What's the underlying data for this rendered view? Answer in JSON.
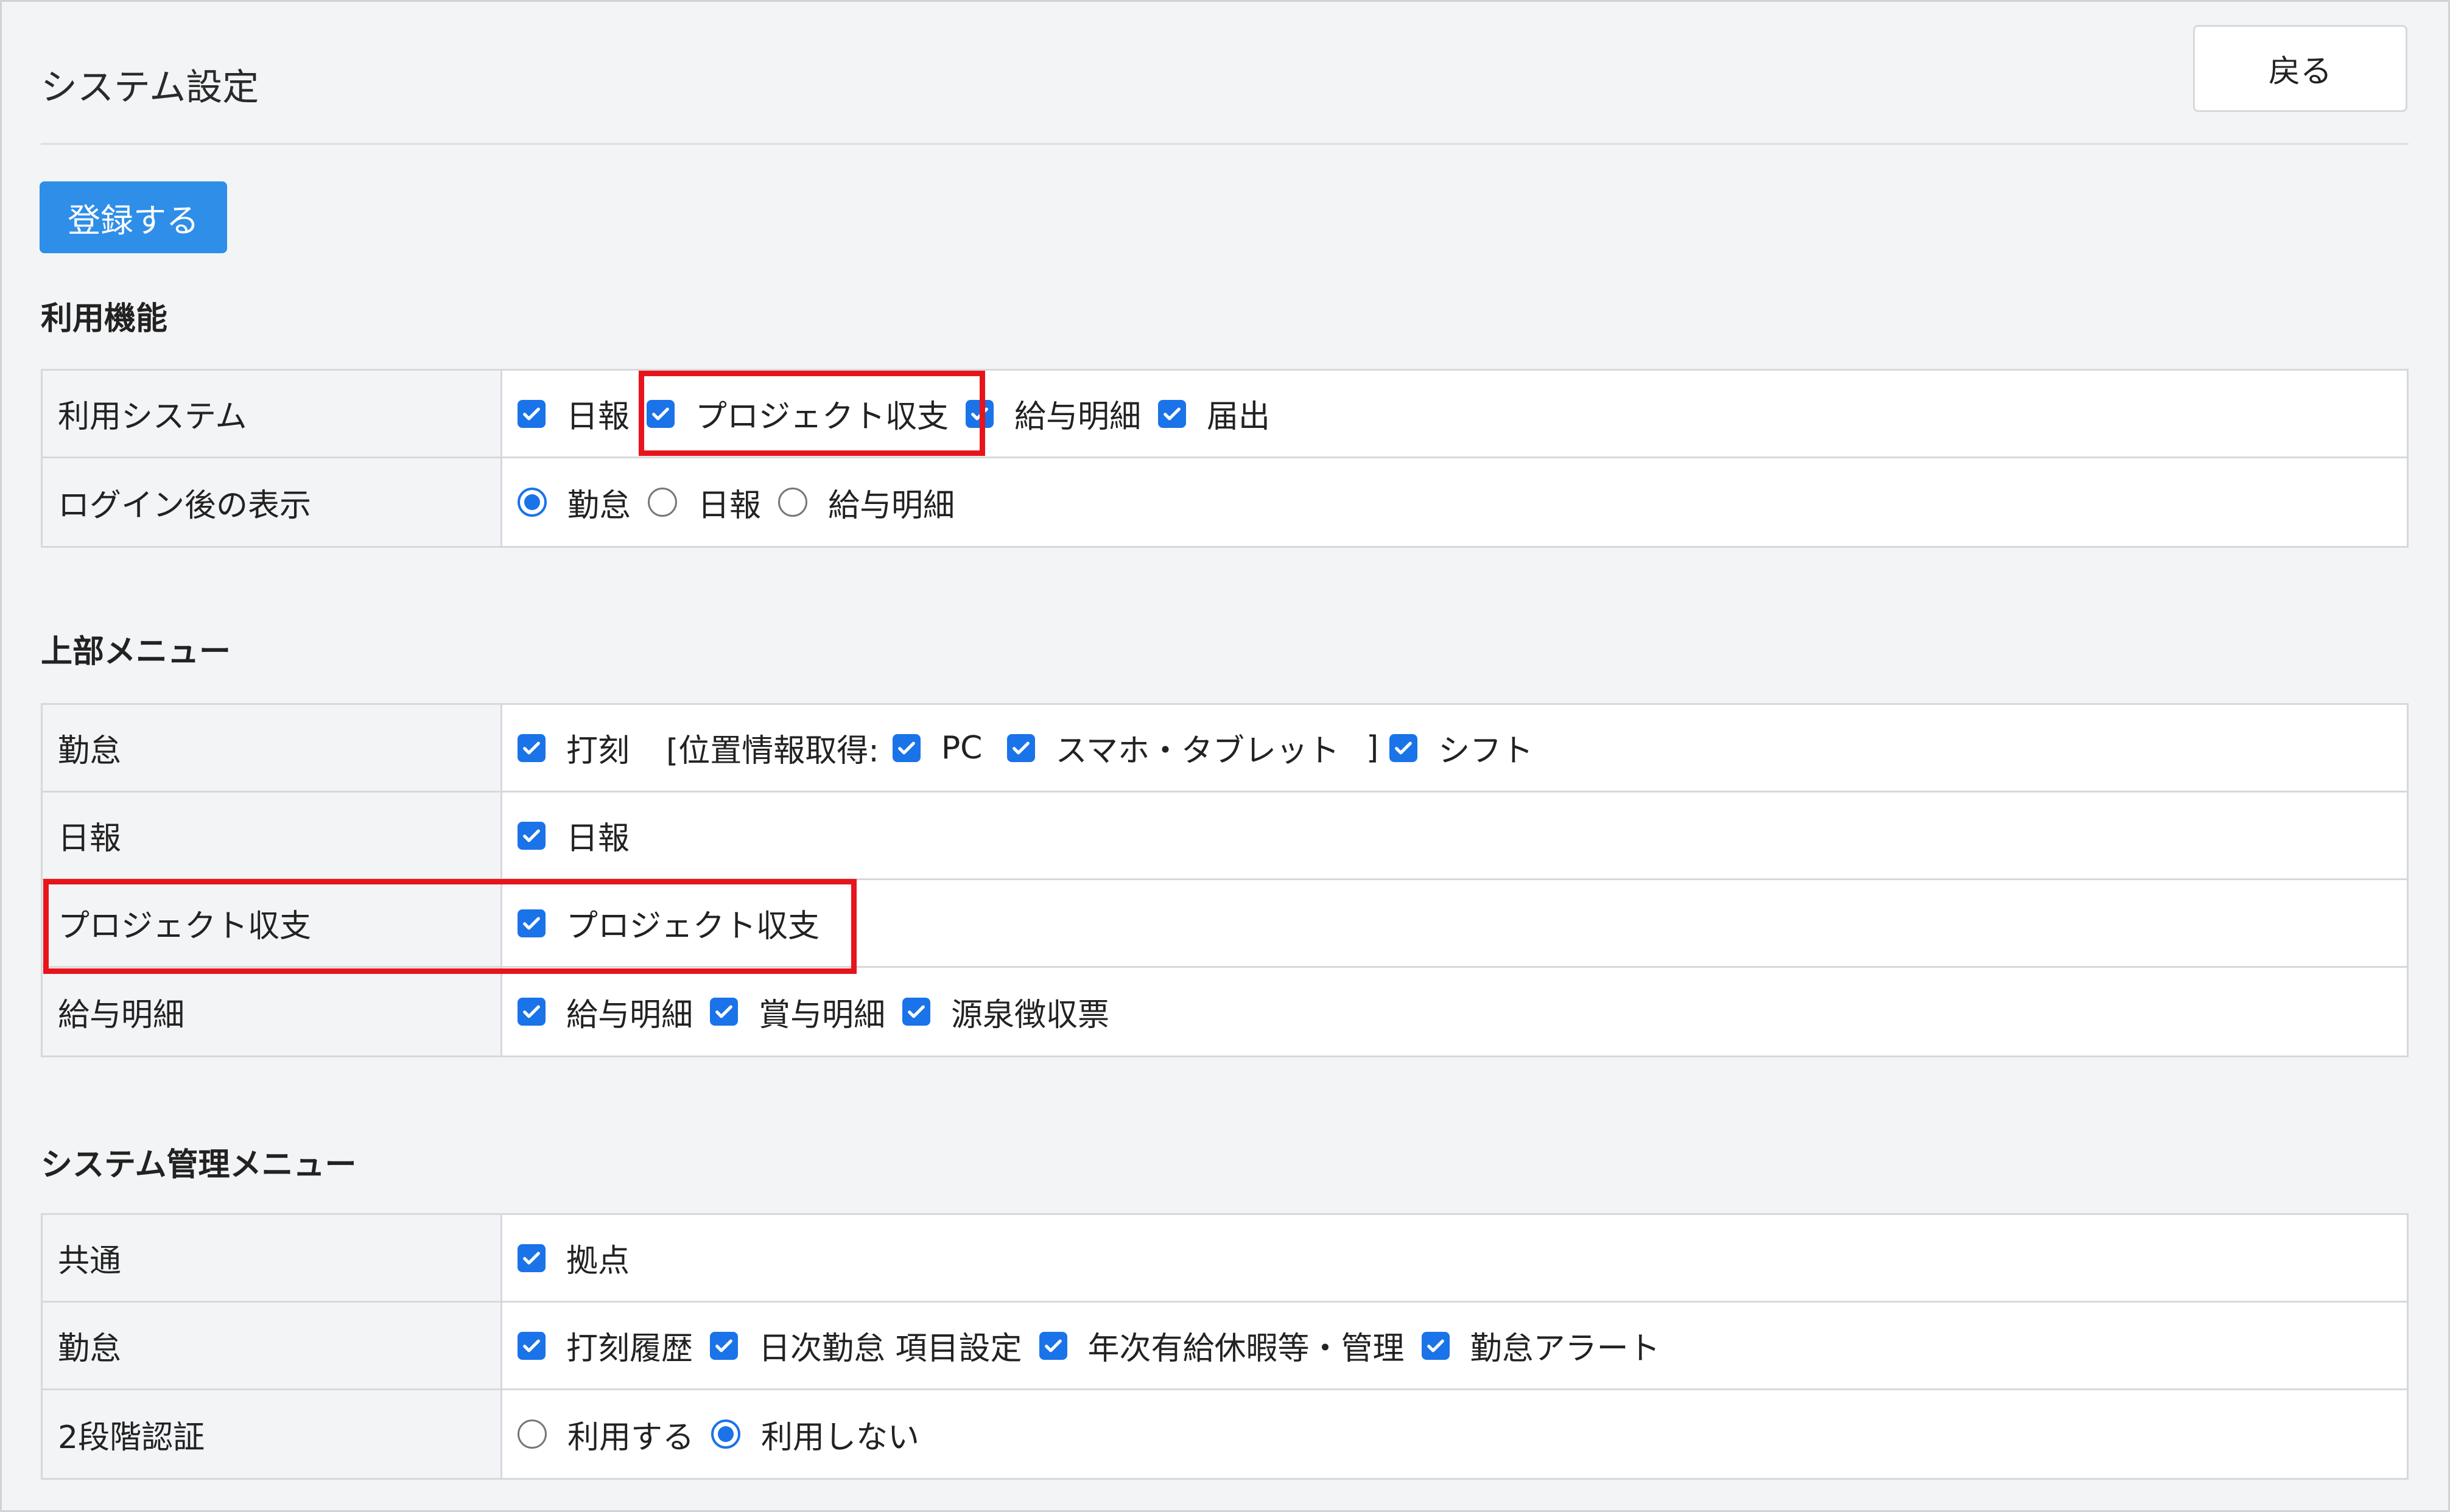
{
  "header": {
    "title": "システム設定",
    "back_label": "戻る"
  },
  "register_label": "登録する",
  "sections": {
    "features": {
      "heading": "利用機能",
      "rows": {
        "system": {
          "label": "利用システム",
          "items": [
            "日報",
            "プロジェクト収支",
            "給与明細",
            "届出"
          ]
        },
        "after_login": {
          "label": "ログイン後の表示",
          "options": [
            "勤怠",
            "日報",
            "給与明細"
          ],
          "selected": "勤怠"
        }
      }
    },
    "top_menu": {
      "heading": "上部メニュー",
      "rows": {
        "attendance": {
          "label": "勤怠",
          "stamp": "打刻",
          "geo_open": "[位置情報取得:",
          "pc": "PC",
          "smartphone": "スマホ・タブレット",
          "geo_close": "]",
          "shift": "シフト"
        },
        "daily_report": {
          "label": "日報",
          "items": [
            "日報"
          ]
        },
        "project": {
          "label": "プロジェクト収支",
          "items": [
            "プロジェクト収支"
          ]
        },
        "payslip": {
          "label": "給与明細",
          "items": [
            "給与明細",
            "賞与明細",
            "源泉徴収票"
          ]
        }
      }
    },
    "admin_menu": {
      "heading": "システム管理メニュー",
      "rows": {
        "common": {
          "label": "共通",
          "items": [
            "拠点"
          ]
        },
        "attendance": {
          "label": "勤怠",
          "items": [
            "打刻履歴",
            "日次勤怠 項目設定",
            "年次有給休暇等・管理",
            "勤怠アラート"
          ]
        },
        "two_factor": {
          "label": "2段階認証",
          "options": [
            "利用する",
            "利用しない"
          ],
          "selected": "利用しない"
        }
      }
    }
  },
  "colors": {
    "accent": "#1a73e8",
    "button": "#2f8ee8",
    "highlight": "#e8141c"
  }
}
